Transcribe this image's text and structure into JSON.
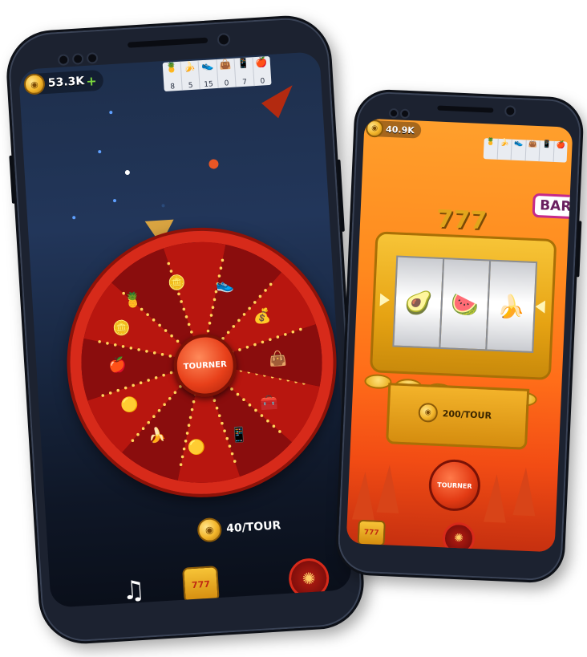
{
  "left_phone": {
    "balance": "53.3K",
    "plus": "+",
    "inventory": [
      {
        "icon": "pineapple",
        "count": "8"
      },
      {
        "icon": "banana",
        "count": "5"
      },
      {
        "icon": "sneaker",
        "count": "15"
      },
      {
        "icon": "handbag",
        "count": "0"
      },
      {
        "icon": "smartphone",
        "count": "7"
      },
      {
        "icon": "apple",
        "count": "0"
      }
    ],
    "spin_button": "TOURNER",
    "cost": "40/TOUR",
    "prizes": [
      "pineapple",
      "coins",
      "sneaker",
      "gold-bag",
      "handbag",
      "treasure-chest",
      "smartphone",
      "coin",
      "banana",
      "coin",
      "apple",
      "coins"
    ]
  },
  "right_phone": {
    "balance": "40.9K",
    "bar_tag": "BAR",
    "slot_title": "777",
    "reels": [
      "avocado",
      "watermelon",
      "banana"
    ],
    "cost": "200/TOUR",
    "spin_button": "TOURNER",
    "inventory": [
      {
        "icon": "pineapple",
        "count": ""
      },
      {
        "icon": "banana",
        "count": ""
      },
      {
        "icon": "sneaker",
        "count": ""
      },
      {
        "icon": "handbag",
        "count": ""
      },
      {
        "icon": "smartphone",
        "count": ""
      },
      {
        "icon": "apple",
        "count": ""
      }
    ]
  },
  "colors": {
    "wheel_rim": "#d72a1a",
    "coin": "#f3b52a",
    "orange_bg": "#ff8a1e"
  }
}
